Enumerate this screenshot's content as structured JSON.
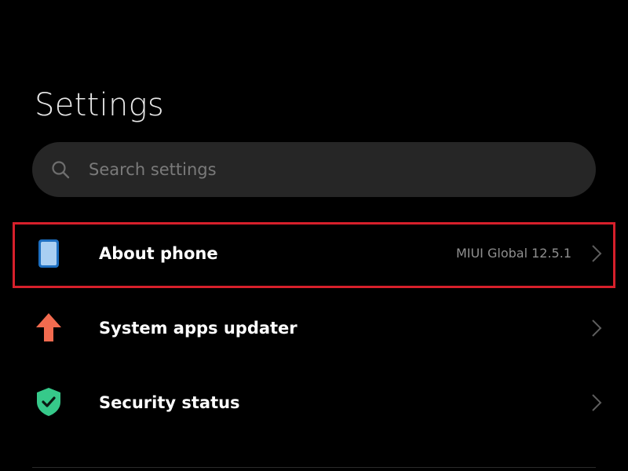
{
  "header": {
    "title": "Settings"
  },
  "search": {
    "placeholder": "Search settings",
    "icon": "search-icon"
  },
  "items": [
    {
      "label": "About phone",
      "value": "MIUI Global 12.5.1",
      "icon": "phone-icon",
      "icon_color": "#2f8fe0",
      "highlighted": true
    },
    {
      "label": "System apps updater",
      "value": "",
      "icon": "arrow-up-icon",
      "icon_color": "#f26b4f"
    },
    {
      "label": "Security status",
      "value": "",
      "icon": "shield-check-icon",
      "icon_color": "#36c98a"
    }
  ],
  "colors": {
    "background": "#000000",
    "search_background": "#262626",
    "highlight": "#d7202b"
  }
}
